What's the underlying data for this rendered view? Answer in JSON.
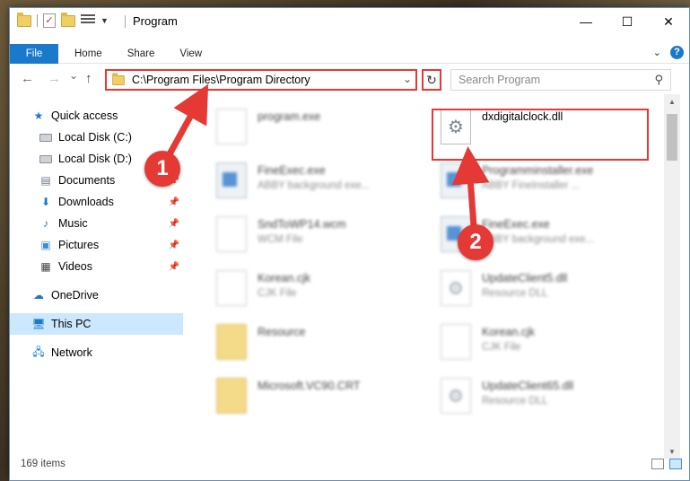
{
  "window": {
    "title": "Program",
    "controls": {
      "minimize": "—",
      "maximize": "☐",
      "close": "✕"
    }
  },
  "ribbon": {
    "tabs": [
      {
        "label": "File"
      },
      {
        "label": "Home"
      },
      {
        "label": "Share"
      },
      {
        "label": "View"
      }
    ],
    "help": "?"
  },
  "nav": {
    "back": "←",
    "forward": "→",
    "recent": "⌄",
    "up": "↑",
    "address": "C:\\Program Files\\Program Directory",
    "refresh": "↻",
    "search_placeholder": "Search Program"
  },
  "sidebar": {
    "items": [
      {
        "label": "Quick access",
        "icon": "star-icon"
      },
      {
        "label": "Local Disk (C:)",
        "icon": "drive-icon"
      },
      {
        "label": "Local Disk (D:)",
        "icon": "drive-icon"
      },
      {
        "label": "Documents",
        "icon": "documents-icon",
        "pinned": true
      },
      {
        "label": "Downloads",
        "icon": "download-icon",
        "pinned": true
      },
      {
        "label": "Music",
        "icon": "music-icon",
        "pinned": true
      },
      {
        "label": "Pictures",
        "icon": "pictures-icon",
        "pinned": true
      },
      {
        "label": "Videos",
        "icon": "videos-icon",
        "pinned": true
      },
      {
        "label": "OneDrive",
        "icon": "cloud-icon"
      },
      {
        "label": "This PC",
        "icon": "computer-icon",
        "selected": true
      },
      {
        "label": "Network",
        "icon": "network-icon"
      }
    ]
  },
  "files": [
    {
      "name": "program.exe",
      "type": "",
      "icon": "installer-icon",
      "blurred": true
    },
    {
      "name": "dxdigitalclock.dll",
      "type": "",
      "icon": "dll-gear-icon",
      "blurred": false
    },
    {
      "name": "FineExec.exe",
      "type": "ABBY background exe...",
      "icon": "exe-icon",
      "blurred": true
    },
    {
      "name": "Programminstaller.exe",
      "type": "ABBY FineInstaller ...",
      "icon": "exe-icon",
      "blurred": true
    },
    {
      "name": "SndToWP14.wcm",
      "type": "WCM File",
      "icon": "document-icon",
      "blurred": true
    },
    {
      "name": "FineExec.exe",
      "type": "ABBY background exe...",
      "icon": "exe-icon",
      "blurred": true
    },
    {
      "name": "Korean.cjk",
      "type": "CJK File",
      "icon": "document-icon",
      "blurred": true
    },
    {
      "name": "UpdateClient5.dll",
      "type": "Resource DLL",
      "icon": "dll-gear-icon",
      "blurred": true
    },
    {
      "name": "Resource",
      "type": "",
      "icon": "folder-icon",
      "blurred": true
    },
    {
      "name": "Korean.cjk",
      "type": "CJK File",
      "icon": "document-icon",
      "blurred": true
    },
    {
      "name": "Microsoft.VC90.CRT",
      "type": "",
      "icon": "folder-icon",
      "blurred": true
    },
    {
      "name": "UpdateClient65.dll",
      "type": "Resource DLL",
      "icon": "dll-gear-icon",
      "blurred": true
    }
  ],
  "status": {
    "item_count": "169 items"
  },
  "annotations": {
    "step1": "1",
    "step2": "2",
    "color": "#e53935"
  }
}
